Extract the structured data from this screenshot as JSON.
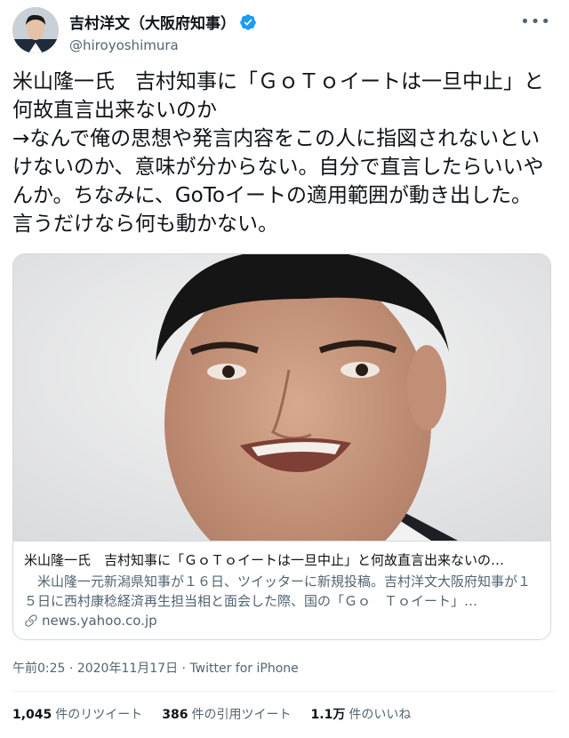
{
  "user": {
    "display_name": "吉村洋文（大阪府知事）",
    "handle": "@hiroyoshimura",
    "more_label": "•••"
  },
  "tweet": {
    "text": "米山隆一氏　吉村知事に「ＧｏＴｏイートは一旦中止」と何故直言出来ないのか\n→なんで俺の思想や発言内容をこの人に指図されないといけないのか、意味が分からない。自分で直言したらいいやんか。ちなみに、GoToイートの適用範囲が動き出した。言うだけなら何も動かない。"
  },
  "card": {
    "title": "米山隆一氏　吉村知事に「ＧｏＴｏイートは一旦中止」と何故直言出来ないの…",
    "description": "　米山隆一元新潟県知事が１６日、ツイッターに新規投稿。吉村洋文大阪府知事が１５日に西村康稔経済再生担当相と面会した際、国の「Ｇｏ　Ｔｏイート」…",
    "domain": "news.yahoo.co.jp"
  },
  "meta": {
    "time": "午前0:25",
    "sep1": " · ",
    "date": "2020年11月17日",
    "sep2": " · ",
    "source": "Twitter for iPhone"
  },
  "stats": {
    "retweets_count": "1,045",
    "retweets_label": "件のリツイート",
    "quotes_count": "386",
    "quotes_label": "件の引用ツイート",
    "likes_count": "1.1万",
    "likes_label": "件のいいね"
  },
  "colors": {
    "verified": "#1d9bf0",
    "text": "#0f1419",
    "secondary": "#536471",
    "border": "#cfd9de"
  },
  "icons": [
    "verified-badge-icon",
    "link-icon",
    "more-icon"
  ]
}
